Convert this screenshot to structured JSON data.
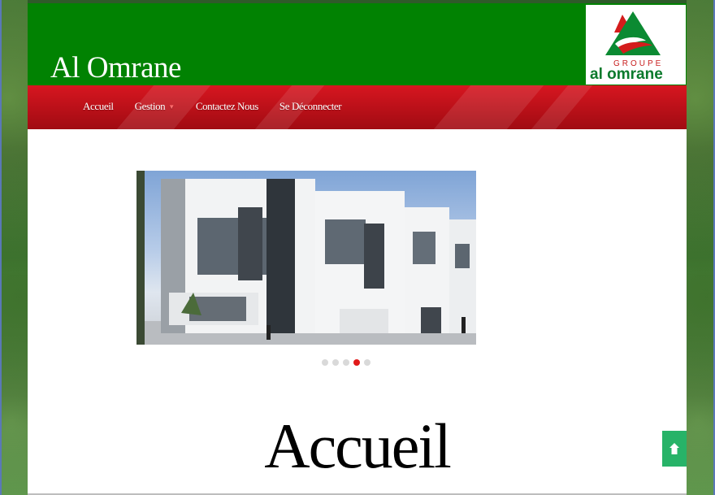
{
  "header": {
    "site_title": "Al Omrane",
    "logo": {
      "groupe": "GROUPE",
      "name": "al omrane"
    }
  },
  "nav": {
    "items": [
      {
        "label": "Accueil"
      },
      {
        "label": "Gestion",
        "has_dropdown": true
      },
      {
        "label": "Contactez Nous"
      },
      {
        "label": "Se Déconnecter"
      }
    ]
  },
  "slider": {
    "image": "modern-white-villas-photo",
    "dots": 5,
    "active_dot": 4
  },
  "main": {
    "heading": "Accueil"
  },
  "scroll_top": {
    "icon": "arrow-up-icon"
  },
  "colors": {
    "header_green": "#018202",
    "nav_red": "#d71620",
    "accent_red": "#e11a1a",
    "scroll_button_green": "#27b368"
  }
}
